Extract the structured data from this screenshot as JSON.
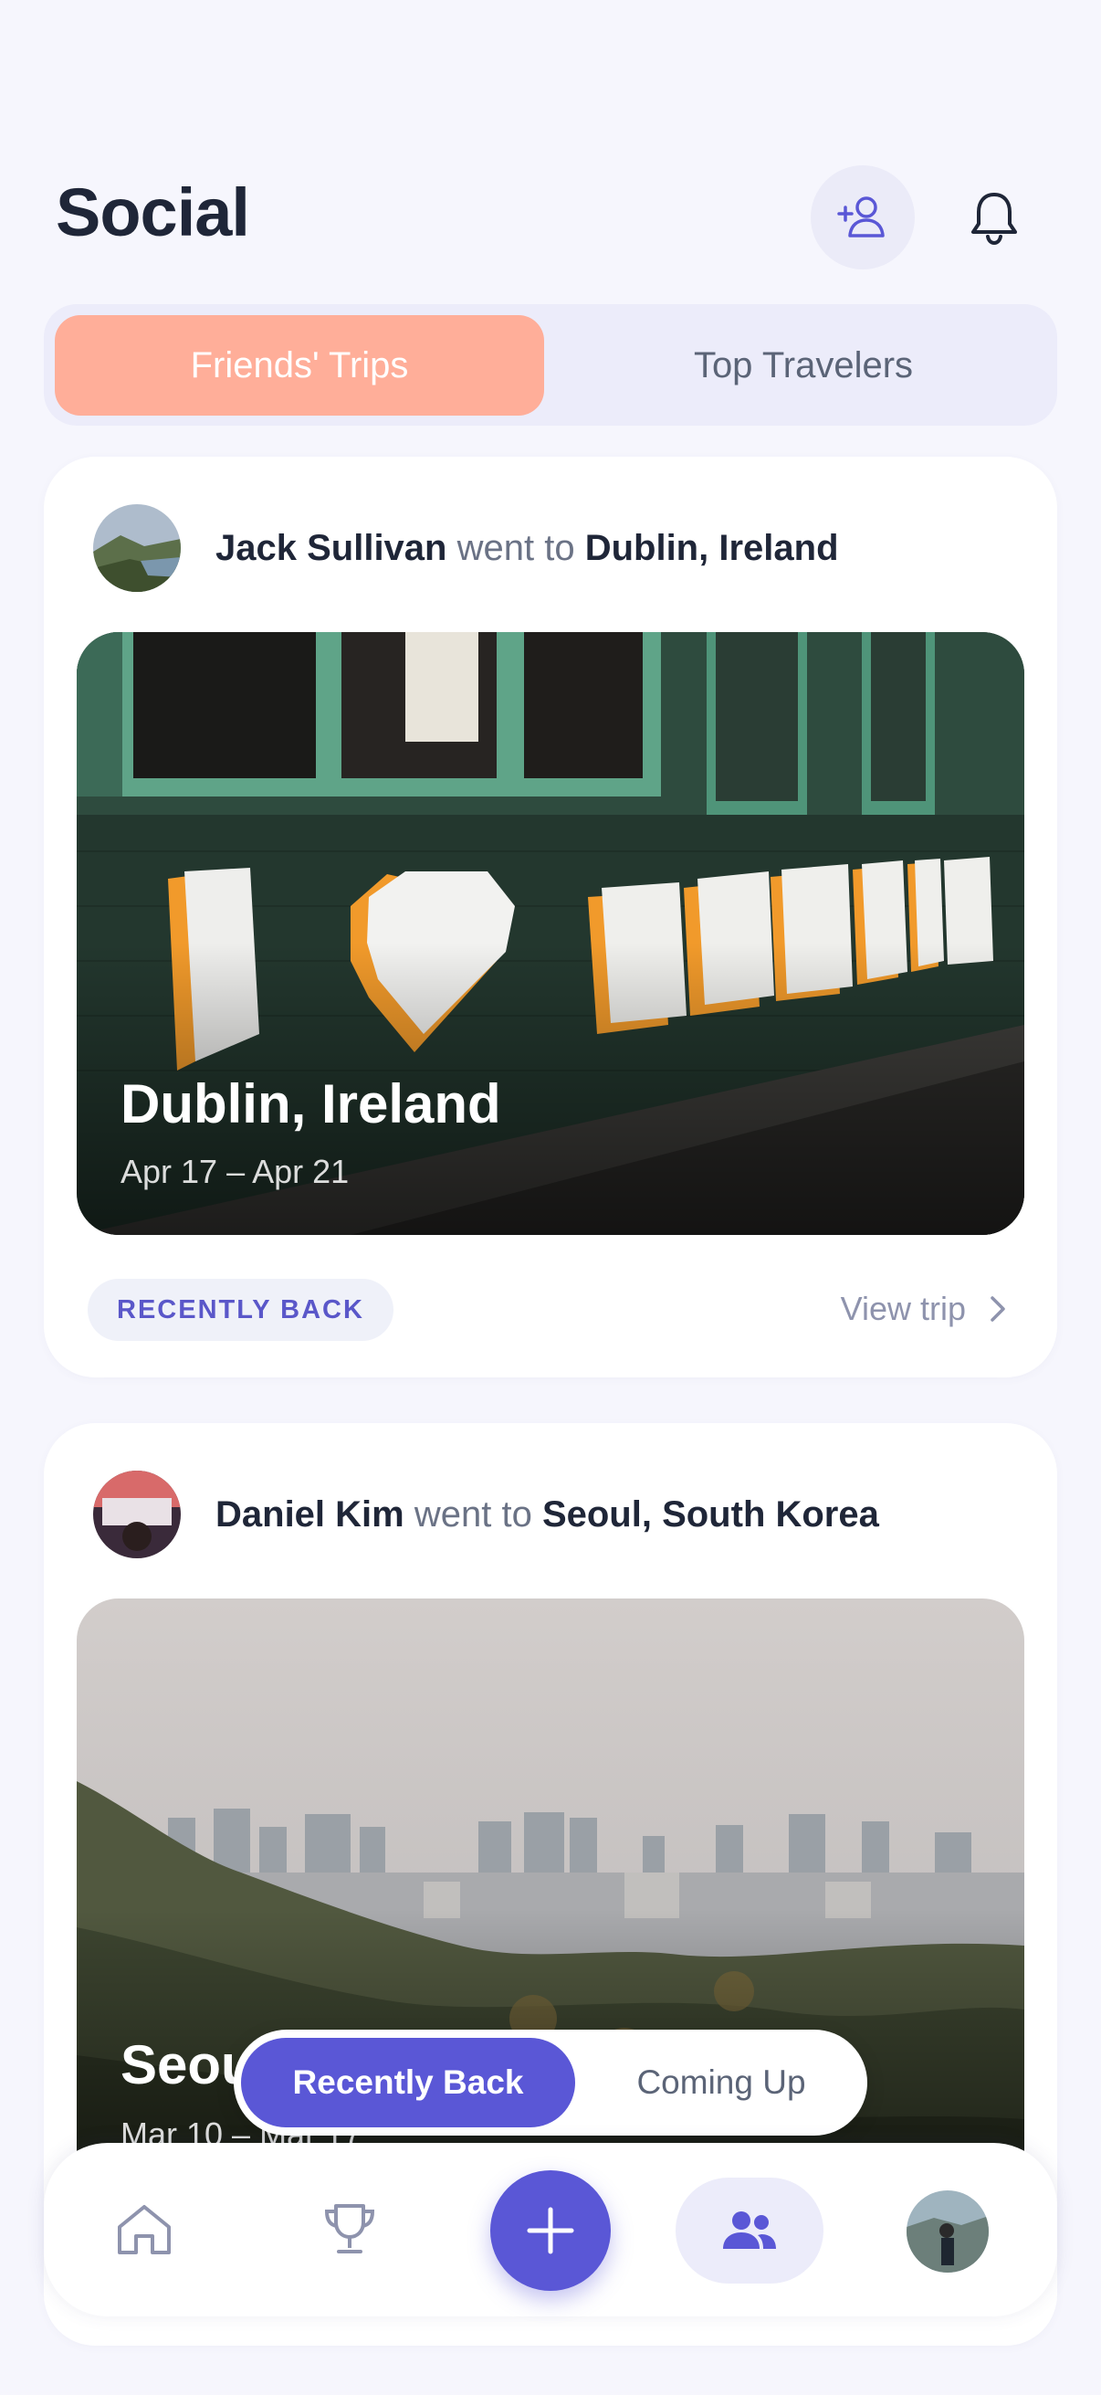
{
  "header": {
    "title": "Social",
    "add_friend_icon": "person-add-icon",
    "notifications_icon": "bell-icon"
  },
  "tabs": [
    {
      "label": "Friends' Trips",
      "active": true
    },
    {
      "label": "Top Travelers",
      "active": false
    }
  ],
  "feed": [
    {
      "user": "Jack Sullivan",
      "verb": "went to",
      "destination": "Dublin, Ireland",
      "photo_title": "Dublin, Ireland",
      "dates": "Apr 17 – Apr 21",
      "badge": "RECENTLY BACK",
      "action": "View trip"
    },
    {
      "user": "Daniel Kim",
      "verb": "went to",
      "destination": "Seoul, South Korea",
      "photo_title": "Seoul",
      "dates": "Mar 10 – Mar 17"
    }
  ],
  "filter": {
    "options": [
      "Recently Back",
      "Coming Up"
    ],
    "selected": "Recently Back"
  },
  "bottom_nav": {
    "items": [
      "home-icon",
      "trophy-icon",
      "plus-icon",
      "people-icon",
      "profile-avatar"
    ],
    "active": "people-icon"
  },
  "colors": {
    "accent": "#5a57d6",
    "tab_active": "#ffae99",
    "background": "#f6f6fd"
  }
}
